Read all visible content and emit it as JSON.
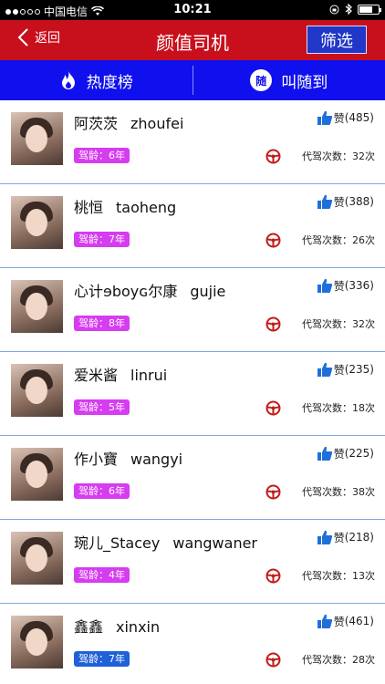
{
  "status_bar": {
    "carrier": "中国电信",
    "time": "10:21"
  },
  "navbar": {
    "back_label": "返回",
    "title": "颜值司机",
    "filter_label": "筛选"
  },
  "tabs": [
    {
      "label": "热度榜",
      "icon": "flame-icon"
    },
    {
      "label": "叫随到",
      "icon": "sui-badge-icon",
      "icon_text": "随"
    }
  ],
  "colors": {
    "nav_red": "#c8101d",
    "tab_blue": "#1010ee",
    "badge_pink": "#d63cf0",
    "badge_blue": "#2060d8",
    "like_blue": "#1e6fd9",
    "wheel_red": "#c31b1b"
  },
  "drivers": [
    {
      "name": "阿茨茨",
      "pinyin": "zhoufei",
      "like_label": "赞",
      "likes": "(485)",
      "driving_age": "驾龄：6年",
      "trips_label": "代驾次数：",
      "trips": "32次",
      "badge_color": "#d63cf0"
    },
    {
      "name": "桃恒",
      "pinyin": "taoheng",
      "like_label": "赞",
      "likes": "(388)",
      "driving_age": "驾龄：7年",
      "trips_label": "代驾次数：",
      "trips": "26次",
      "badge_color": "#d63cf0"
    },
    {
      "name": "心计ɘboyɢ尔康",
      "pinyin": "gujie",
      "like_label": "赞",
      "likes": "(336)",
      "driving_age": "驾龄：8年",
      "trips_label": "代驾次数：",
      "trips": "32次",
      "badge_color": "#d63cf0"
    },
    {
      "name": "爱米酱",
      "pinyin": "linrui",
      "like_label": "赞",
      "likes": "(235)",
      "driving_age": "驾龄：5年",
      "trips_label": "代驾次数：",
      "trips": "18次",
      "badge_color": "#d63cf0"
    },
    {
      "name": "作小寶",
      "pinyin": "wangyi",
      "like_label": "赞",
      "likes": "(225)",
      "driving_age": "驾龄：6年",
      "trips_label": "代驾次数：",
      "trips": "38次",
      "badge_color": "#d63cf0"
    },
    {
      "name": "琬儿_Stacey",
      "pinyin": "wangwaner",
      "like_label": "赞",
      "likes": "(218)",
      "driving_age": "驾龄：4年",
      "trips_label": "代驾次数：",
      "trips": "13次",
      "badge_color": "#d63cf0"
    },
    {
      "name": "鑫鑫",
      "pinyin": "xinxin",
      "like_label": "赞",
      "likes": "(461)",
      "driving_age": "驾龄：7年",
      "trips_label": "代驾次数：",
      "trips": "28次",
      "badge_color": "#2060d8"
    }
  ]
}
